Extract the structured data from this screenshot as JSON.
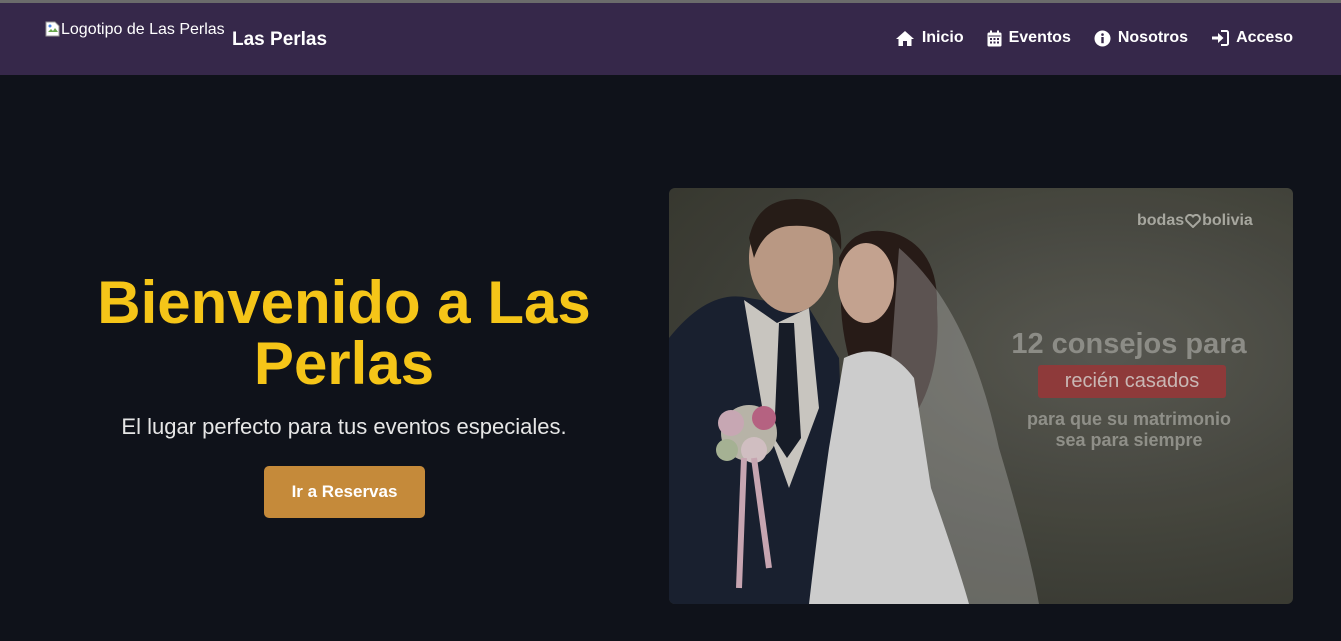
{
  "navbar": {
    "logo_alt": "Logotipo de Las Perlas",
    "brand_name": "Las Perlas",
    "items": [
      {
        "label": "Inicio",
        "icon": "home-icon"
      },
      {
        "label": "Eventos",
        "icon": "calendar-icon"
      },
      {
        "label": "Nosotros",
        "icon": "info-icon"
      },
      {
        "label": "Acceso",
        "icon": "sign-in-icon"
      }
    ]
  },
  "hero": {
    "title": "Bienvenido a Las Perlas",
    "subtitle": "El lugar perfecto para tus eventos especiales.",
    "cta_label": "Ir a Reservas"
  },
  "hero_image": {
    "watermark_left": "bodas",
    "watermark_right": "bolivia",
    "headline": "12 consejos para",
    "badge": "recién casados",
    "line1": "para que su matrimonio",
    "line2": "sea para siempre"
  },
  "colors": {
    "navbar_bg": "#36284a",
    "page_bg": "#0f121a",
    "title_accent": "#f5c518",
    "button_bg": "#c58a3a"
  }
}
